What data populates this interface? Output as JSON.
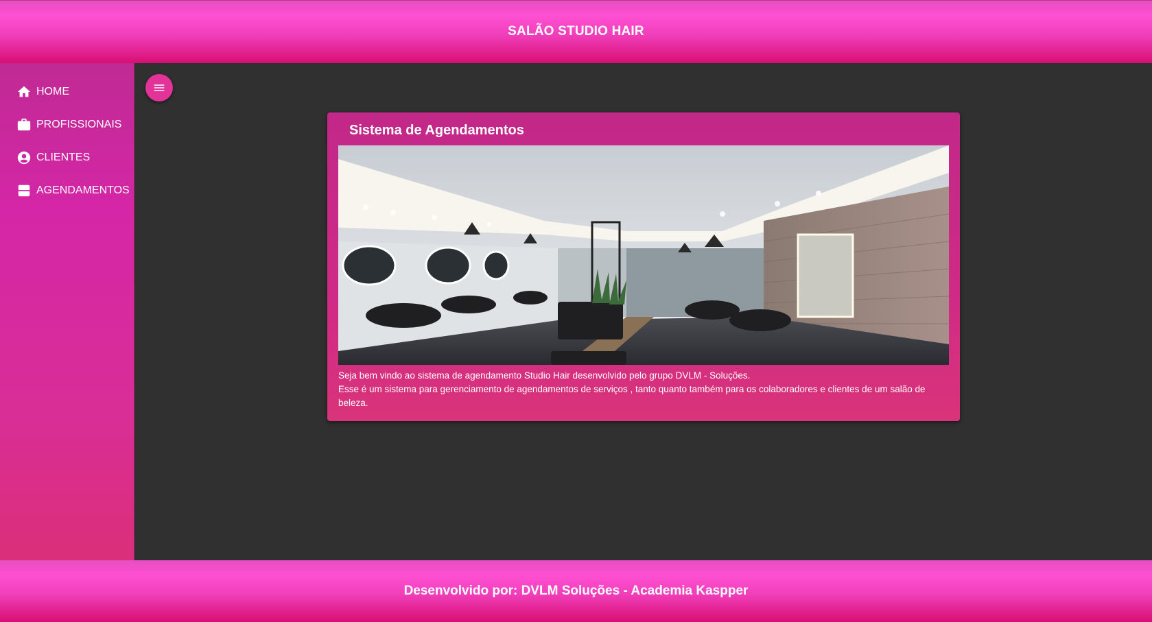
{
  "header": {
    "title": "SALÃO STUDIO HAIR"
  },
  "sidebar": {
    "items": [
      {
        "label": "HOME",
        "icon": "home-icon"
      },
      {
        "label": "PROFISSIONAIS",
        "icon": "briefcase-icon"
      },
      {
        "label": "CLIENTES",
        "icon": "account-circle-icon"
      },
      {
        "label": "AGENDAMENTOS",
        "icon": "calendar-view-icon"
      }
    ]
  },
  "toolbar": {
    "menu_icon": "menu-icon"
  },
  "card": {
    "title": "Sistema de Agendamentos",
    "image_description": "salon-interior-photo",
    "text_line1": "Seja bem vindo ao sistema de agendamento Studio Hair desenvolvido pelo grupo DVLM - Soluções.",
    "text_line2": "Esse é um sistema para gerenciamento de agendamentos de serviços , tanto quanto também para os colaboradores e clientes de um salão de beleza."
  },
  "footer": {
    "credits": "Desenvolvido por: DVLM Soluções - Academia Kaspper"
  },
  "colors": {
    "brand_pink": "#ff4fd2",
    "brand_dark_pink": "#d80f73",
    "sidebar": "#d526a7",
    "background": "#303030",
    "card": "#cf2b86"
  }
}
